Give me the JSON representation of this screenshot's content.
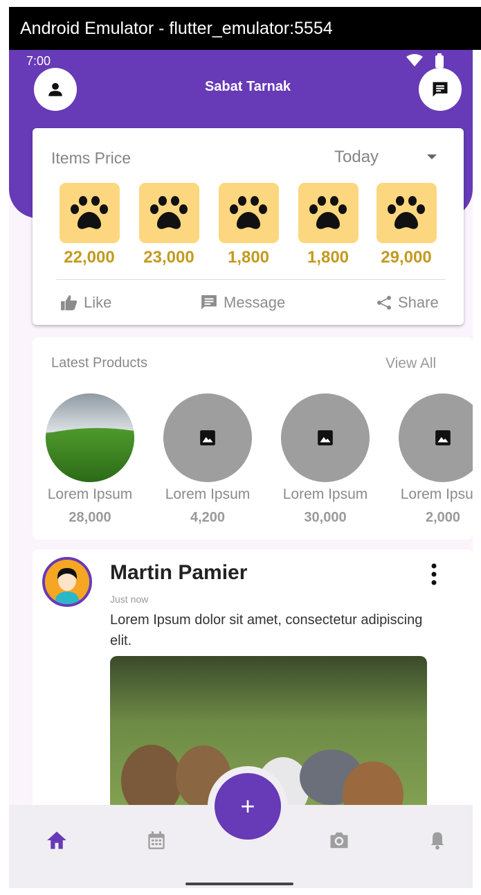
{
  "window": {
    "title": "Android Emulator - flutter_emulator:5554"
  },
  "status_bar": {
    "time": "7:00"
  },
  "header": {
    "title": "Sabat Tarnak",
    "left_icon": "person-icon",
    "right_icon": "chat-icon",
    "color": "#673ab7"
  },
  "price_card": {
    "title": "Items Price",
    "period": "Today",
    "items": [
      {
        "icon": "paw-icon",
        "price": "22,000"
      },
      {
        "icon": "paw-icon",
        "price": "23,000"
      },
      {
        "icon": "paw-icon",
        "price": "1,800"
      },
      {
        "icon": "paw-icon",
        "price": "1,800"
      },
      {
        "icon": "paw-icon",
        "price": "29,000"
      }
    ],
    "actions": {
      "like": "Like",
      "message": "Message",
      "share": "Share"
    }
  },
  "products": {
    "title": "Latest Products",
    "view_all": "View All",
    "items": [
      {
        "name": "Lorem Ipsum",
        "price": "28,000",
        "image": "field-photo"
      },
      {
        "name": "Lorem Ipsum",
        "price": "4,200",
        "image": "placeholder-image-icon"
      },
      {
        "name": "Lorem Ipsum",
        "price": "30,000",
        "image": "placeholder-image-icon"
      },
      {
        "name": "Lorem Ipsum",
        "price": "2,000",
        "image": "placeholder-image-icon"
      }
    ]
  },
  "post": {
    "author": "Martin Pamier",
    "time": "Just now",
    "text": "Lorem Ipsum dolor sit amet, consectetur adipiscing elit.",
    "image": "chicks-photo"
  },
  "bottom_nav": {
    "items": [
      "home-icon",
      "calendar-icon",
      "camera-icon",
      "bell-icon"
    ],
    "fab": "+"
  }
}
